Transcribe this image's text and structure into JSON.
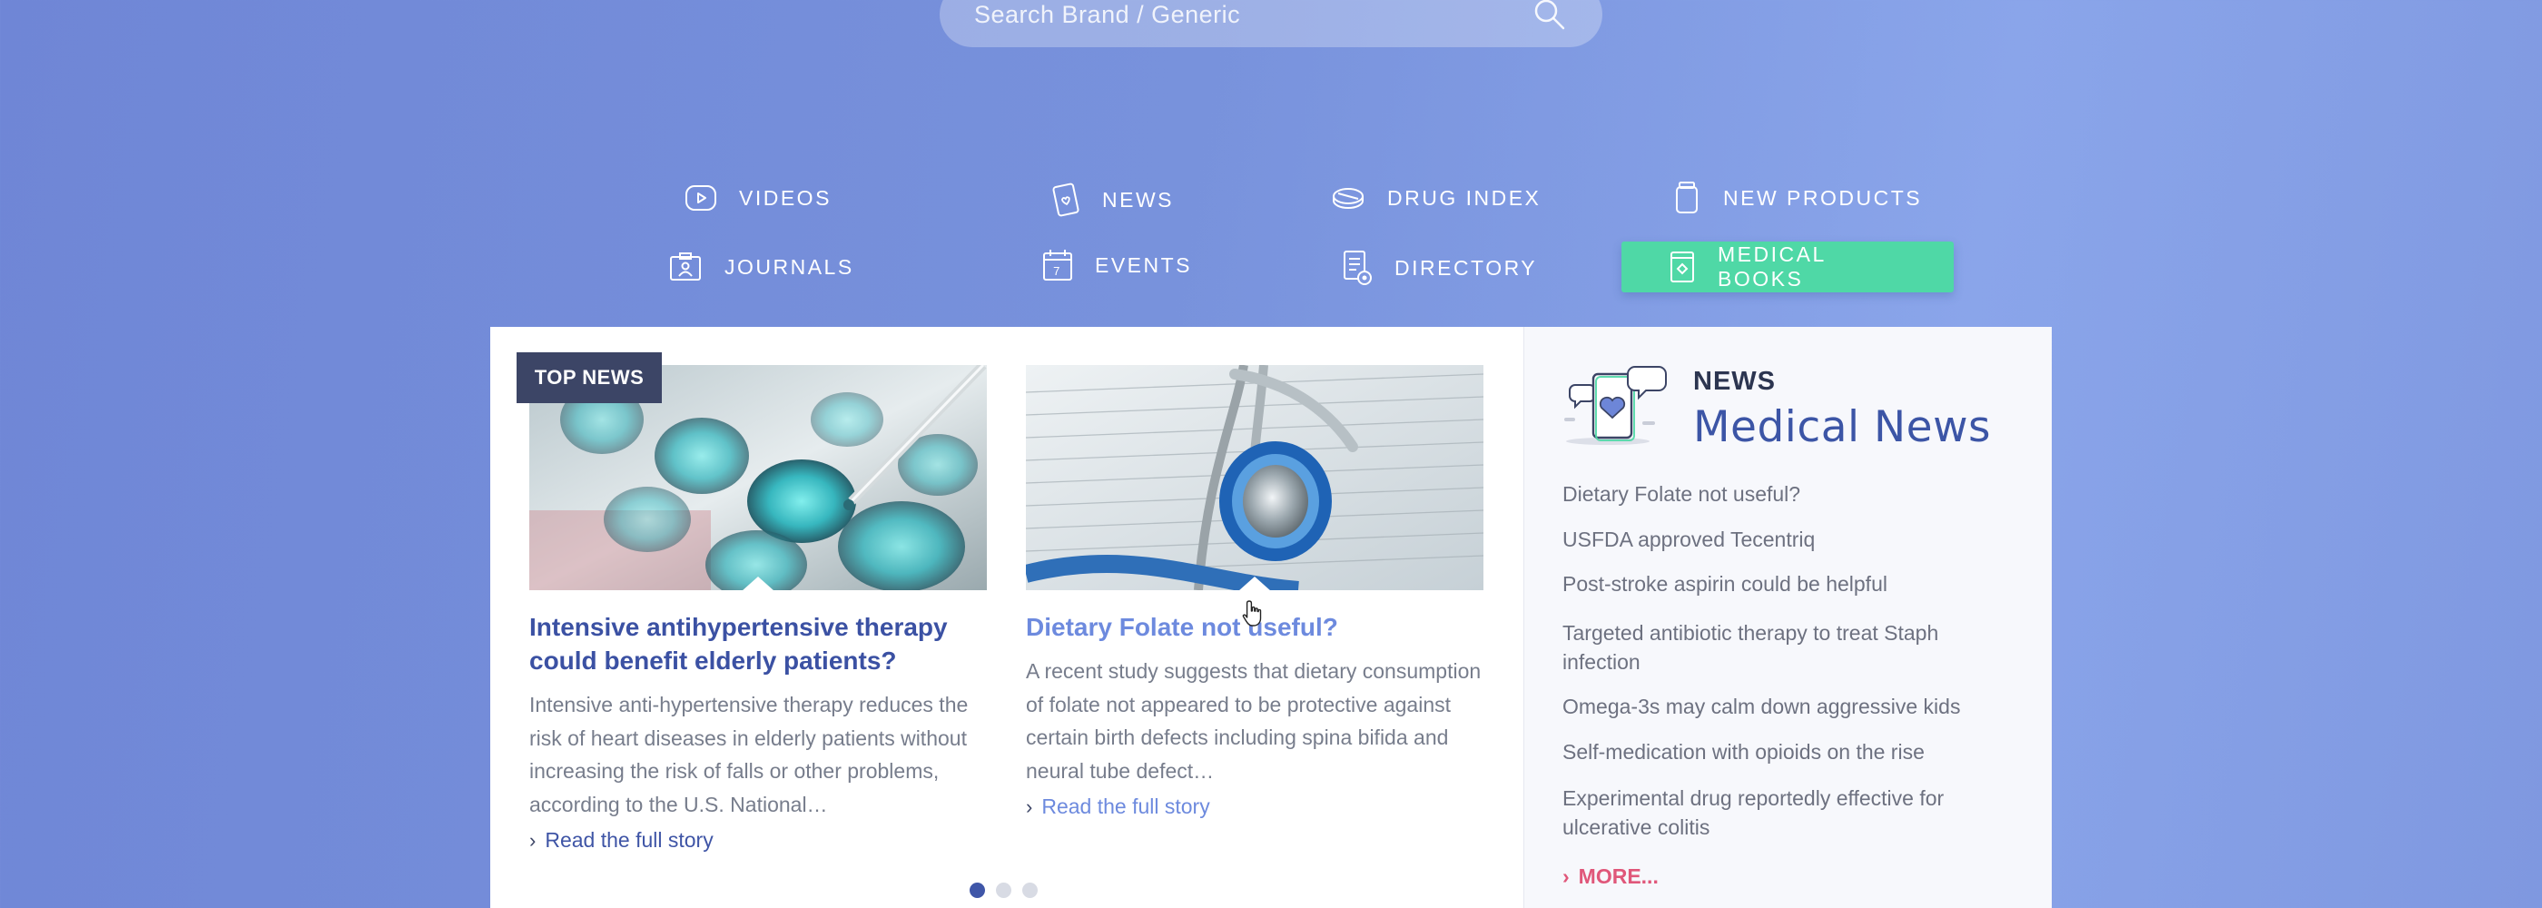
{
  "search": {
    "placeholder": "Search Brand / Generic"
  },
  "nav": {
    "items": [
      {
        "label": "VIDEOS",
        "icon": "video-icon"
      },
      {
        "label": "NEWS",
        "icon": "news-icon"
      },
      {
        "label": "DRUG INDEX",
        "icon": "pill-icon"
      },
      {
        "label": "NEW PRODUCTS",
        "icon": "product-icon"
      },
      {
        "label": "JOURNALS",
        "icon": "journal-icon"
      },
      {
        "label": "EVENTS",
        "icon": "calendar-icon"
      },
      {
        "label": "DIRECTORY",
        "icon": "directory-icon"
      },
      {
        "label": "MEDICAL BOOKS",
        "icon": "book-icon"
      }
    ],
    "active": "MEDICAL BOOKS",
    "active_color": "#4fd8a6"
  },
  "top_news": {
    "badge": "TOP NEWS",
    "articles": [
      {
        "title": "Intensive antihypertensive therapy could benefit elderly patients?",
        "body": "Intensive anti-hypertensive therapy reduces the risk of heart diseases in elderly patients without increasing the risk of falls or other problems, according to the U.S. National…",
        "link": "Read the full story",
        "image": "lab-pipette-image"
      },
      {
        "title": "Dietary Folate not useful?",
        "body": "A recent study suggests that dietary consumption of folate not appeared to be protective against certain birth defects including spina bifida and neural tube defect…",
        "link": "Read the full story",
        "image": "stethoscope-image"
      }
    ],
    "pages": 3,
    "active_page": 1
  },
  "sidebar": {
    "kicker": "NEWS",
    "title": "Medical News",
    "items": [
      "Dietary Folate not useful?",
      "USFDA approved Tecentriq",
      "Post-stroke aspirin could be helpful",
      "Targeted antibiotic therapy to treat Staph infection",
      "Omega-3s may calm down aggressive kids",
      "Self-medication with opioids on the rise",
      "Experimental drug reportedly effective for ulcerative colitis"
    ],
    "more": "MORE..."
  },
  "colors": {
    "primary": "#3f55a6",
    "accent_green": "#4fd8a6",
    "more_link": "#e0577a",
    "badge": "#3c4566"
  }
}
